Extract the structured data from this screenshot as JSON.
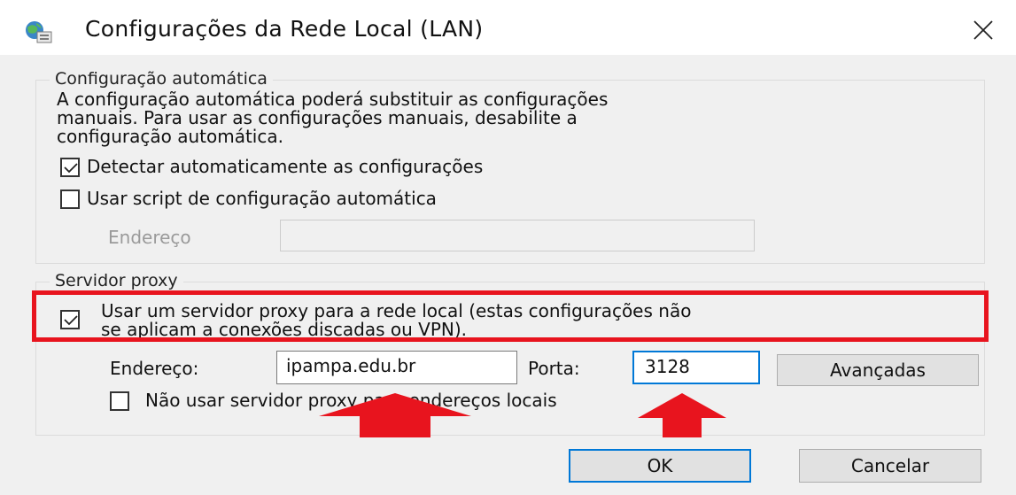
{
  "window": {
    "title": "Configurações da Rede Local (LAN)",
    "icon": "network-settings-icon",
    "close_icon": "close-icon"
  },
  "auto_config": {
    "legend": "Configuração automática",
    "description_lines": [
      "A configuração automática poderá substituir as configurações",
      "manuais. Para usar as configurações manuais, desabilite a",
      "configuração automática."
    ],
    "detect_label": "Detectar automaticamente as configurações",
    "detect_checked": true,
    "script_label": "Usar script de configuração automática",
    "script_checked": false,
    "address_label": "Endereço",
    "address_value": ""
  },
  "proxy": {
    "legend": "Servidor proxy",
    "use_proxy_lines": [
      "Usar um servidor proxy para a rede local (estas configurações não",
      "se aplicam a conexões discadas ou VPN)."
    ],
    "use_proxy_checked": true,
    "address_label": "Endereço:",
    "address_value": "ipampa.edu.br",
    "port_label": "Porta:",
    "port_value": "3128",
    "advanced_label": "Avançadas",
    "bypass_label": "Não usar servidor proxy para endereços locais",
    "bypass_checked": false
  },
  "buttons": {
    "ok_label": "OK",
    "cancel_label": "Cancelar"
  },
  "annotations": {
    "highlight_color": "#e8141e",
    "arrow_color": "#e8141e"
  }
}
